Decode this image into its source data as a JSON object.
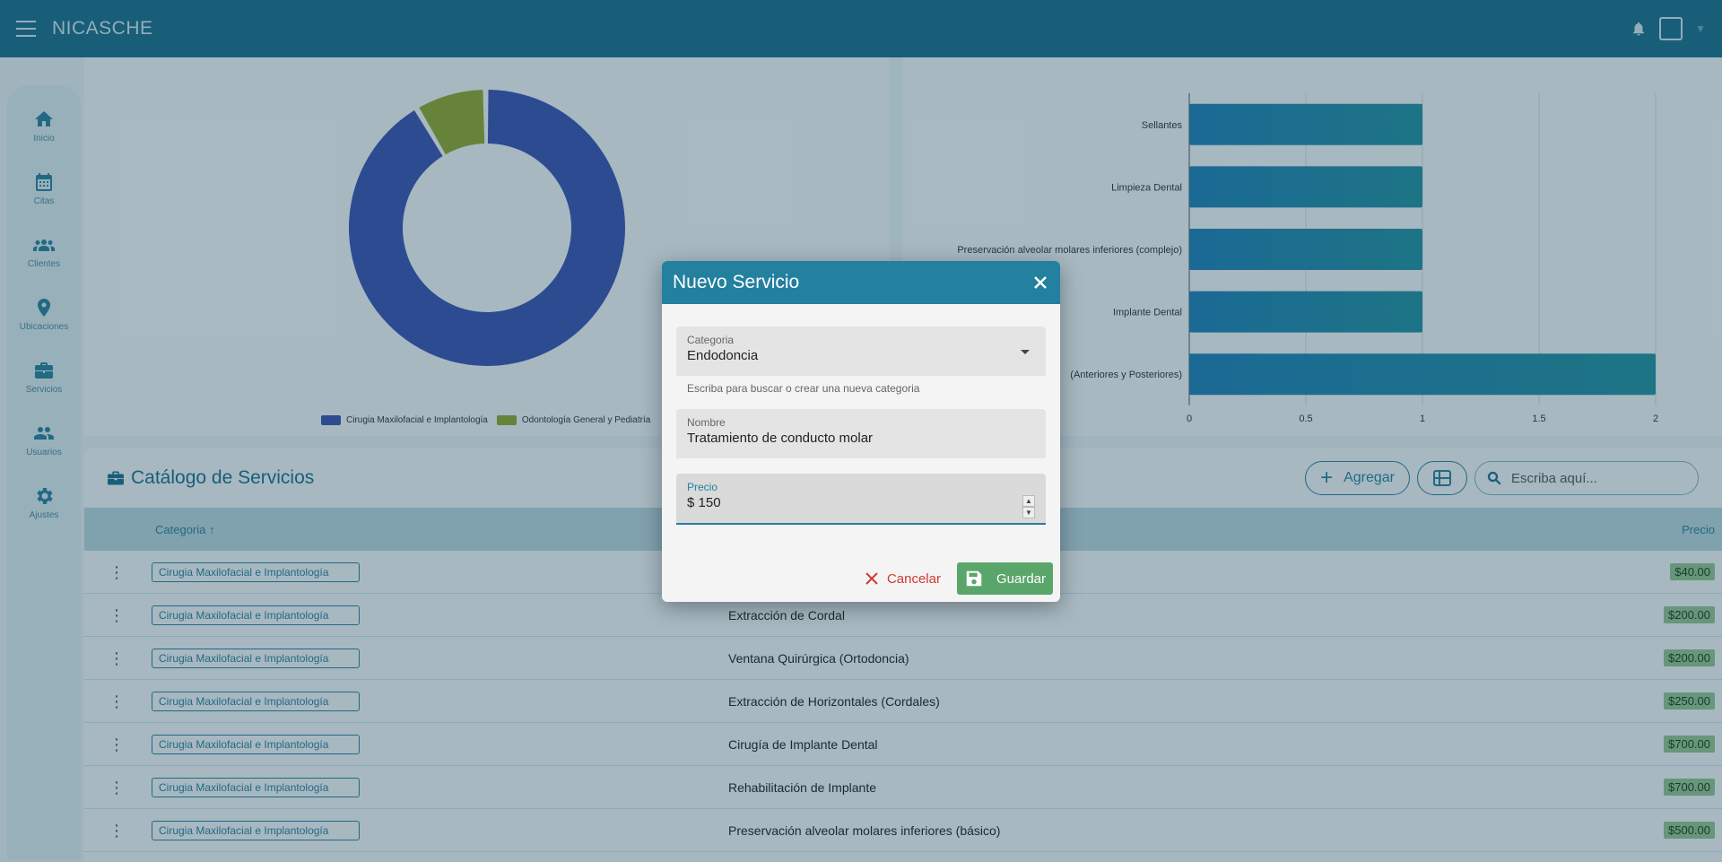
{
  "app": {
    "title": "NICASCHE"
  },
  "sidebar": {
    "items": [
      {
        "label": "Inicio",
        "icon": "home-icon"
      },
      {
        "label": "Citas",
        "icon": "calendar-icon"
      },
      {
        "label": "Clientes",
        "icon": "people-icon"
      },
      {
        "label": "Ubicaciones",
        "icon": "location-pin-icon"
      },
      {
        "label": "Servicios",
        "icon": "briefcase-icon"
      },
      {
        "label": "Usuarios",
        "icon": "users-icon"
      },
      {
        "label": "Ajustes",
        "icon": "gear-icon"
      }
    ]
  },
  "chart_data": [
    {
      "type": "pie",
      "donut": true,
      "slices": [
        {
          "label": "Cirugia Maxilofacial e Implantología",
          "value": 11,
          "color": "#3a53b0"
        },
        {
          "label": "Odontología General y Pediatría",
          "value": 1,
          "color": "#8fa630"
        }
      ],
      "legend": [
        "Cirugia Maxilofacial e Implantología",
        "Odontología General y Pediatría"
      ],
      "legend_placement": "bottom"
    },
    {
      "type": "bar",
      "orientation": "horizontal",
      "categories": [
        "Sellantes",
        "Limpieza Dental",
        "Preservación alveolar molares inferiores (complejo)",
        "Implante Dental",
        "(Anteriores y Posteriores)"
      ],
      "values": [
        1,
        1,
        1,
        1,
        2
      ],
      "xlim": [
        0,
        2
      ],
      "xticks": [
        "0",
        "0.5",
        "1",
        "1.5",
        "2"
      ],
      "grid": true,
      "color": "#1f80b6"
    }
  ],
  "catalog": {
    "title": "Catálogo de Servicios",
    "add_label": "Agregar",
    "search_placeholder": "Escriba aquí...",
    "columns": {
      "category": "Categoria",
      "price": "Precio"
    },
    "rows": [
      {
        "category": "Cirugia Maxilofacial e Implantología",
        "name": "",
        "price": "$40.00"
      },
      {
        "category": "Cirugia Maxilofacial e Implantología",
        "name": "Extracción de Cordal",
        "price": "$200.00"
      },
      {
        "category": "Cirugia Maxilofacial e Implantología",
        "name": "Ventana Quirúrgica (Ortodoncia)",
        "price": "$200.00"
      },
      {
        "category": "Cirugia Maxilofacial e Implantología",
        "name": "Extracción de Horizontales (Cordales)",
        "price": "$250.00"
      },
      {
        "category": "Cirugia Maxilofacial e Implantología",
        "name": "Cirugía de Implante Dental",
        "price": "$700.00"
      },
      {
        "category": "Cirugia Maxilofacial e Implantología",
        "name": "Rehabilitación de Implante",
        "price": "$700.00"
      },
      {
        "category": "Cirugia Maxilofacial e Implantología",
        "name": "Preservación alveolar molares inferiores (básico)",
        "price": "$500.00"
      }
    ]
  },
  "modal": {
    "title": "Nuevo Servicio",
    "category": {
      "label": "Categoria",
      "value": "Endodoncia",
      "helper": "Escriba para buscar o crear una nueva categoria"
    },
    "name": {
      "label": "Nombre",
      "value": "Tratamiento de conducto molar"
    },
    "price": {
      "label": "Precio",
      "value": "$ 150"
    },
    "cancel_label": "Cancelar",
    "save_label": "Guardar"
  },
  "colors": {
    "primary": "#1b6f8c",
    "save": "#5aa66a",
    "cancel": "#d03a30",
    "price_badge": "#8fc18f"
  }
}
